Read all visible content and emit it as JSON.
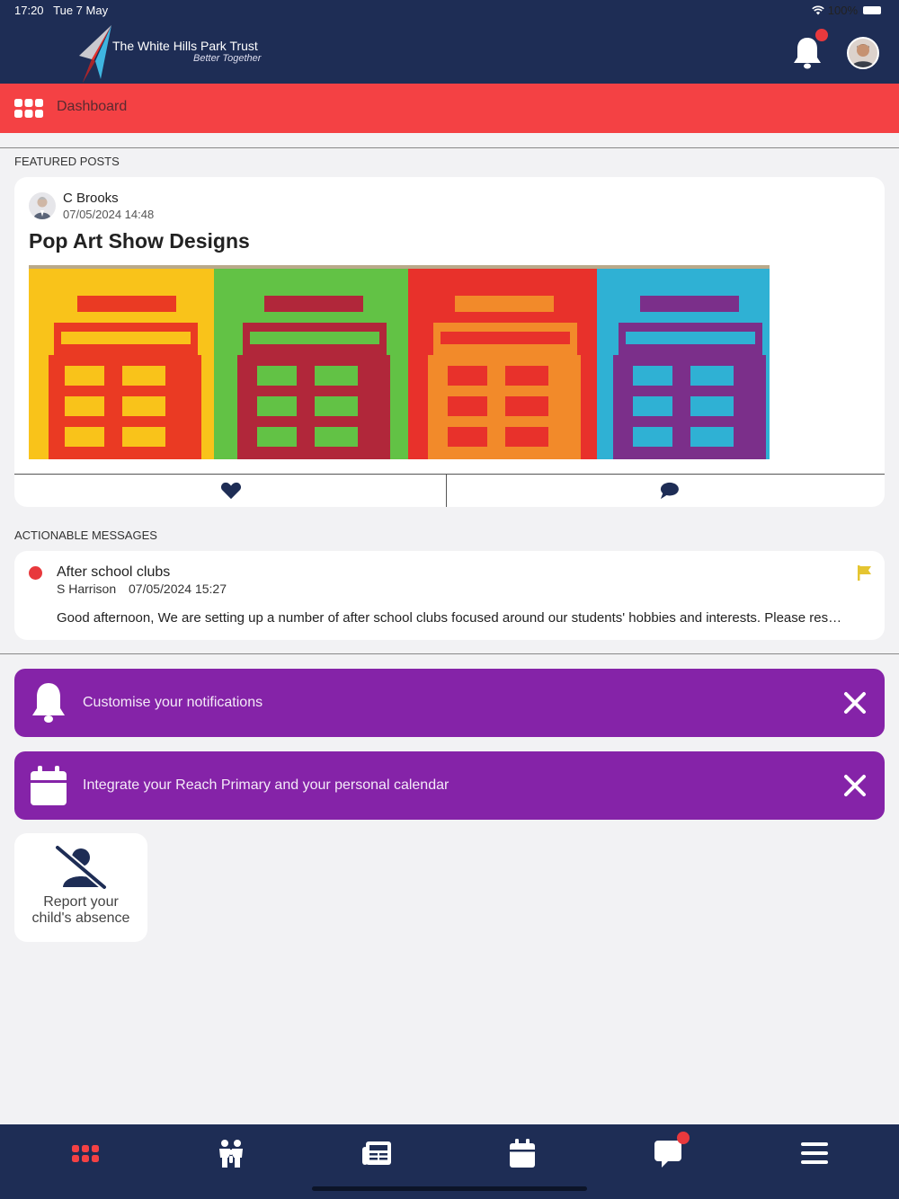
{
  "status_bar": {
    "time": "17:20",
    "date": "Tue 7 May",
    "battery": "100%",
    "icons": [
      "wifi-icon",
      "battery-icon"
    ]
  },
  "header": {
    "org_name": "The White Hills Park Trust",
    "tagline": "Better Together",
    "bell_has_badge": true,
    "colors": {
      "bar": "#1e2d55",
      "badge": "#e8393d"
    }
  },
  "subheader": {
    "title": "Dashboard",
    "icon": "grid-icon",
    "color": "#f44144"
  },
  "featured": {
    "section_label": "FEATURED POSTS",
    "post": {
      "author": "C Brooks",
      "date": "07/05/2024 14:48",
      "title": "Pop Art Show Designs",
      "image_panels": [
        "#f9c31a",
        "#62c245",
        "#e8312b",
        "#2fb1d4"
      ],
      "actions": [
        "heart-icon",
        "comment-icon"
      ]
    }
  },
  "actionable": {
    "section_label": "ACTIONABLE MESSAGES",
    "message": {
      "title": "After school clubs",
      "sender": "S Harrison",
      "date": "07/05/2024 15:27",
      "body": "Good afternoon, We are setting up a number of after school clubs focused around our students' hobbies and interests. Please res…",
      "flag_color": "#e5c531"
    }
  },
  "banners": [
    {
      "text": "Customise your notifications",
      "icon": "bell-icon"
    },
    {
      "text": "Integrate your Reach Primary and your personal calendar",
      "icon": "calendar-icon"
    }
  ],
  "quick_tile": {
    "label": "Report your\nchild's absence",
    "icon": "person-off-icon"
  },
  "bottom_nav": {
    "items": [
      "home-grid-icon",
      "family-icon",
      "news-icon",
      "calendar-icon",
      "messages-icon",
      "menu-icon"
    ],
    "active": "home-grid-icon",
    "messages_has_badge": true
  }
}
